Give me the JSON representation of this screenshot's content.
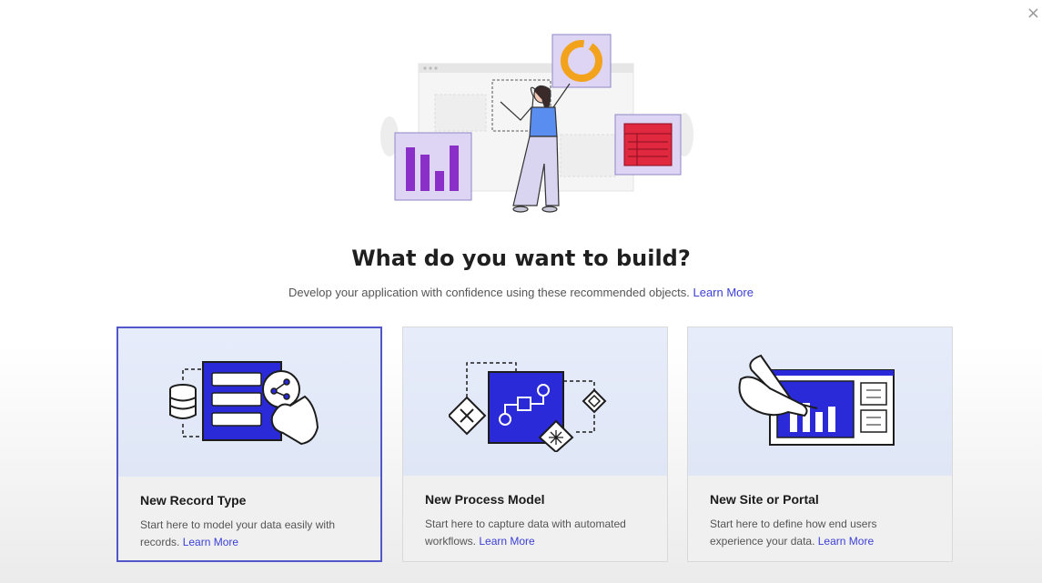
{
  "close_label": "×",
  "heading": "What do you want to build?",
  "subtitle": {
    "text": "Develop your application with confidence using these recommended objects.",
    "link": "Learn More"
  },
  "cards": [
    {
      "title": "New Record Type",
      "description": "Start here to model your data easily with records.",
      "link": "Learn More",
      "selected": true,
      "icon": "record-type-icon"
    },
    {
      "title": "New Process Model",
      "description": "Start here to capture data with automated workflows.",
      "link": "Learn More",
      "selected": false,
      "icon": "process-model-icon"
    },
    {
      "title": "New Site or Portal",
      "description": "Start here to define how end users experience your data.",
      "link": "Learn More",
      "selected": false,
      "icon": "site-portal-icon"
    }
  ],
  "colors": {
    "accent": "#3b3fd6",
    "card_art_bg": "#e6ecfa",
    "selected_border": "#5157c9",
    "chart_purple": "#8a2fc7",
    "donut_orange": "#f2a21b",
    "table_red": "#e0283f"
  }
}
